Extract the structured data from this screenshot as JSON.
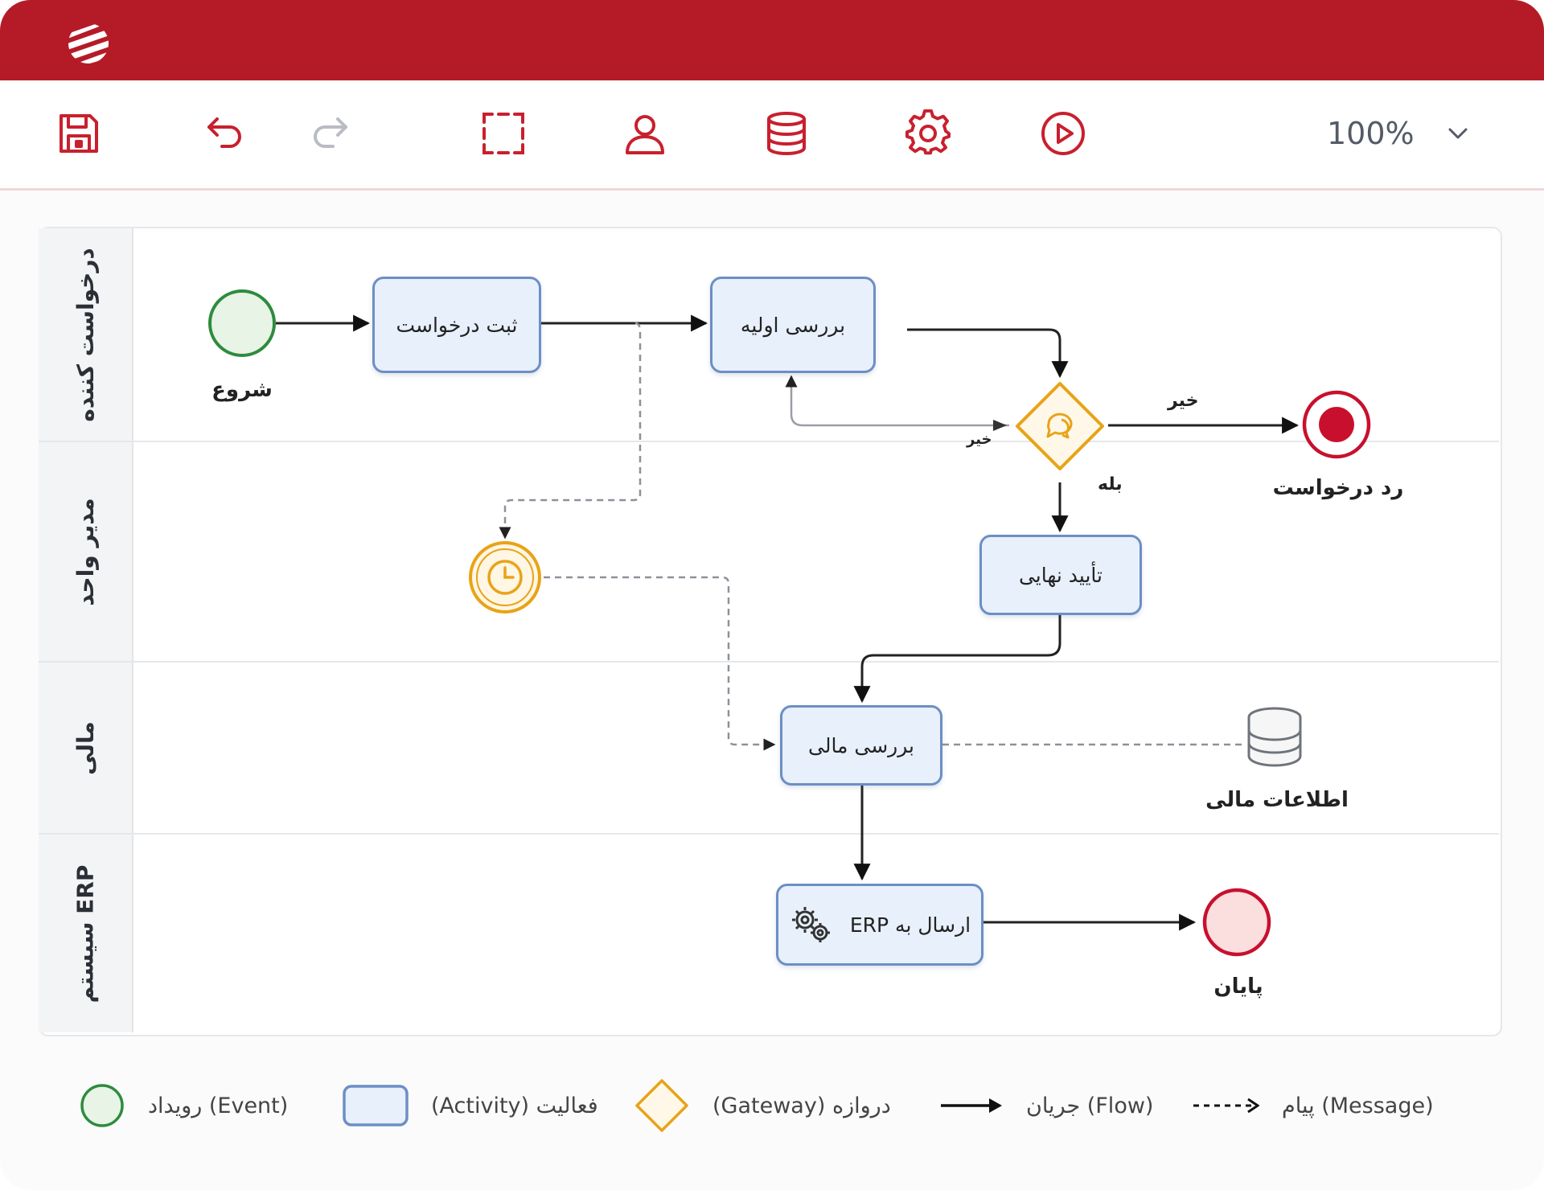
{
  "app": {
    "accent": "#b51b27",
    "logo_icon": "logo-stripes-icon"
  },
  "toolbar": {
    "buttons": [
      {
        "name": "save",
        "icon": "save-icon"
      },
      {
        "name": "undo",
        "icon": "undo-icon"
      },
      {
        "name": "redo",
        "icon": "redo-icon"
      },
      {
        "name": "select",
        "icon": "select-frame-icon"
      },
      {
        "name": "user",
        "icon": "user-icon"
      },
      {
        "name": "database",
        "icon": "database-icon"
      },
      {
        "name": "settings",
        "icon": "gear-icon"
      },
      {
        "name": "run",
        "icon": "play-icon"
      }
    ],
    "zoom": "100%"
  },
  "lanes": [
    {
      "label": "درخواست کننده"
    },
    {
      "label": "مدیر واحد"
    },
    {
      "label": "مالی"
    },
    {
      "label": "سیستم ERP"
    }
  ],
  "nodes": {
    "start": {
      "label": "شروع",
      "color": "#2e8b3e"
    },
    "register": {
      "label": "ثبت درخواست"
    },
    "initial_review": {
      "label": "بررسی اولیه"
    },
    "gateway": {
      "color": "#e8a317"
    },
    "reject": {
      "label": "رد درخواست",
      "color": "#c8102e"
    },
    "final_approval": {
      "label": "تأیید نهایی"
    },
    "financial_review": {
      "label": "بررسی مالی"
    },
    "send_erp": {
      "label": "ارسال به ERP",
      "icon": "gears-icon"
    },
    "end": {
      "label": "پایان",
      "color": "#c8102e"
    },
    "financial_data": {
      "label": "اطلاعات مالی",
      "icon": "database-icon"
    },
    "timer": {
      "icon": "clock-icon",
      "color": "#e8a317"
    }
  },
  "edges": {
    "no": "خیر",
    "yes": "بله",
    "return": "خیر"
  },
  "legend": [
    {
      "text": "(Event) رویداد"
    },
    {
      "text": "فعالیت (Activity)"
    },
    {
      "text": "دروازه (Gateway)"
    },
    {
      "text": "(Flow) جریان"
    },
    {
      "text": "(Message) پیام"
    }
  ]
}
